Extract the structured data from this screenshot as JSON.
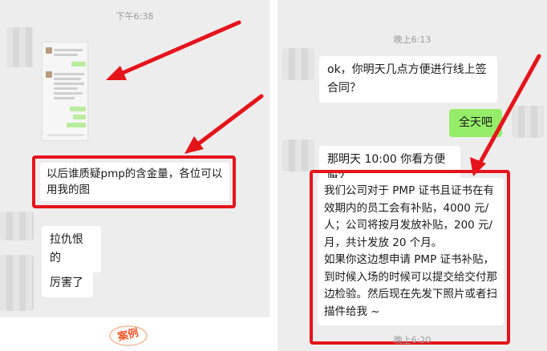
{
  "left_chat": {
    "timestamp": "下午6:38",
    "messages": [
      {
        "text": "以后谁质疑pmp的含金量，各位可以用我的图"
      },
      {
        "text": "拉仇恨的"
      },
      {
        "text": "厉害了"
      }
    ]
  },
  "right_chat": {
    "timestamp_top": "晚上6:13",
    "timestamp_bottom": "晚上6:20",
    "messages": [
      {
        "side": "incoming",
        "text": "ok，你明天几点方便进行线上签合同？"
      },
      {
        "side": "outgoing",
        "text": "全天吧"
      },
      {
        "side": "incoming",
        "text": "那明天 10:00 你看方便嘛？"
      },
      {
        "side": "incoming",
        "text": "我们公司对于 PMP 证书且证书在有效期内的员工会有补贴，4000 元/人；公司将按月发放补贴，200 元/月，共计发放 20 个月。\n如果你这边想申请 PMP 证书补贴，到时候入场的时候可以提交给交付那边检验。然后现在先发下照片或者扫描件给我 ~"
      }
    ]
  },
  "stamp": {
    "text": "案例"
  },
  "colors": {
    "highlight": "#e5141b",
    "outgoing_bubble": "#95ec69",
    "chat_bg": "#ededed",
    "stamp": "#f0582a"
  },
  "icons": [
    "arrow-icon"
  ]
}
